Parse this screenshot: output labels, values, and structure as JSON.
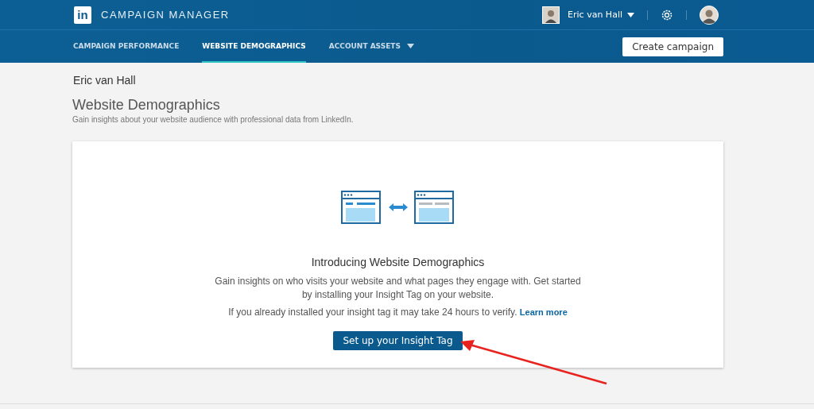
{
  "header": {
    "logo": "in",
    "product": "CAMPAIGN MANAGER",
    "account": "Eric van Hall"
  },
  "tabs": [
    {
      "label": "CAMPAIGN PERFORMANCE",
      "selected": false,
      "dropdown": false
    },
    {
      "label": "WEBSITE DEMOGRAPHICS",
      "selected": true,
      "dropdown": false
    },
    {
      "label": "ACCOUNT ASSETS",
      "selected": false,
      "dropdown": true
    }
  ],
  "create_button": "Create campaign",
  "account_name": "Eric van Hall",
  "page": {
    "title": "Website Demographics",
    "subtitle": "Gain insights about your website audience with professional data from LinkedIn."
  },
  "card": {
    "heading": "Introducing Website Demographics",
    "body": "Gain insights on who visits your website and what pages they engage with. Get started by installing your Insight Tag on your website.",
    "note": "If you already installed your insight tag it may take 24 hours to verify.",
    "link": "Learn more",
    "button": "Set up your Insight Tag"
  }
}
